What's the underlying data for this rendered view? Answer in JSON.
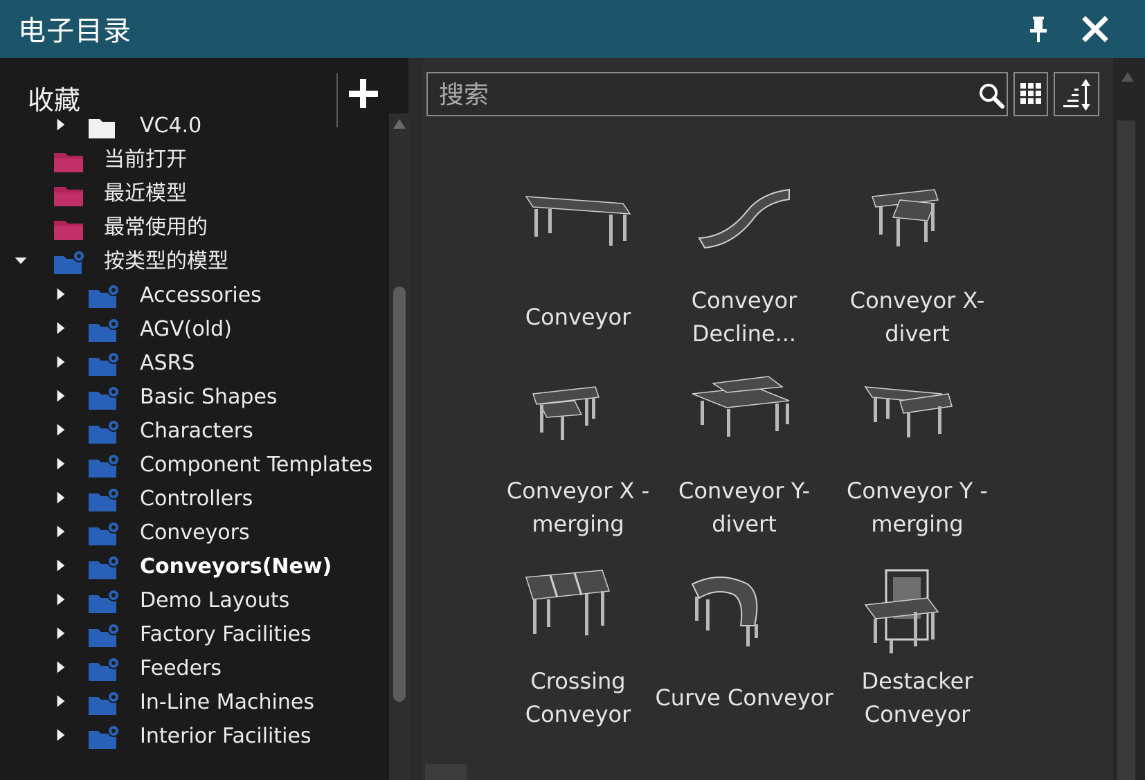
{
  "window": {
    "title": "电子目录",
    "pin_icon": "pin-icon",
    "close_icon": "close-icon",
    "accent": "#1c5469"
  },
  "sidebar": {
    "favorites_label": "收藏",
    "add_icon": "plus-icon",
    "items": [
      {
        "label": "VC4.0",
        "icon": "white-folder-icon",
        "arrow": "right",
        "indent": 1
      },
      {
        "label": "当前打开",
        "icon": "pink-folder-icon",
        "arrow": "none",
        "indent": 0
      },
      {
        "label": "最近模型",
        "icon": "pink-folder-icon",
        "arrow": "none",
        "indent": 0
      },
      {
        "label": "最常使用的",
        "icon": "pink-folder-icon",
        "arrow": "none",
        "indent": 0
      },
      {
        "label": "按类型的模型",
        "icon": "blue-gear-folder-icon",
        "arrow": "down",
        "indent": 0
      },
      {
        "label": "Accessories",
        "icon": "blue-gear-folder-icon",
        "arrow": "right",
        "indent": 1
      },
      {
        "label": "AGV(old)",
        "icon": "blue-gear-folder-icon",
        "arrow": "right",
        "indent": 1
      },
      {
        "label": "ASRS",
        "icon": "blue-gear-folder-icon",
        "arrow": "right",
        "indent": 1
      },
      {
        "label": "Basic Shapes",
        "icon": "blue-gear-folder-icon",
        "arrow": "right",
        "indent": 1
      },
      {
        "label": "Characters",
        "icon": "blue-gear-folder-icon",
        "arrow": "right",
        "indent": 1
      },
      {
        "label": "Component Templates",
        "icon": "blue-gear-folder-icon",
        "arrow": "right",
        "indent": 1
      },
      {
        "label": "Controllers",
        "icon": "blue-gear-folder-icon",
        "arrow": "right",
        "indent": 1
      },
      {
        "label": "Conveyors",
        "icon": "blue-gear-folder-icon",
        "arrow": "right",
        "indent": 1
      },
      {
        "label": "Conveyors(New)",
        "icon": "blue-gear-folder-icon",
        "arrow": "right",
        "indent": 1,
        "selected": true
      },
      {
        "label": "Demo Layouts",
        "icon": "blue-gear-folder-icon",
        "arrow": "right",
        "indent": 1
      },
      {
        "label": "Factory Facilities",
        "icon": "blue-gear-folder-icon",
        "arrow": "right",
        "indent": 1
      },
      {
        "label": "Feeders",
        "icon": "blue-gear-folder-icon",
        "arrow": "right",
        "indent": 1
      },
      {
        "label": "In-Line Machines",
        "icon": "blue-gear-folder-icon",
        "arrow": "right",
        "indent": 1
      },
      {
        "label": "Interior Facilities",
        "icon": "blue-gear-folder-icon",
        "arrow": "right",
        "indent": 1
      }
    ]
  },
  "search": {
    "placeholder": "搜索",
    "value": "",
    "search_icon": "magnifier-icon",
    "grid_icon": "grid-view-icon",
    "sort_icon": "sort-icon"
  },
  "catalog": {
    "items": [
      {
        "line1": "Conveyor",
        "line2": "",
        "thumb": "conveyor-thumb"
      },
      {
        "line1": "Conveyor",
        "line2": "Decline...",
        "thumb": "conveyor-decline-thumb"
      },
      {
        "line1": "Conveyor X-",
        "line2": "divert",
        "thumb": "conveyor-x-divert-thumb"
      },
      {
        "line1": "Conveyor X -",
        "line2": "merging",
        "thumb": "conveyor-x-merging-thumb"
      },
      {
        "line1": "Conveyor Y-",
        "line2": "divert",
        "thumb": "conveyor-y-divert-thumb"
      },
      {
        "line1": "Conveyor Y -",
        "line2": "merging",
        "thumb": "conveyor-y-merging-thumb"
      },
      {
        "line1": "Crossing",
        "line2": "Conveyor",
        "thumb": "crossing-conveyor-thumb"
      },
      {
        "line1": "Curve Conveyor",
        "line2": "",
        "thumb": "curve-conveyor-thumb"
      },
      {
        "line1": "Destacker",
        "line2": "Conveyor",
        "thumb": "destacker-conveyor-thumb"
      }
    ]
  }
}
